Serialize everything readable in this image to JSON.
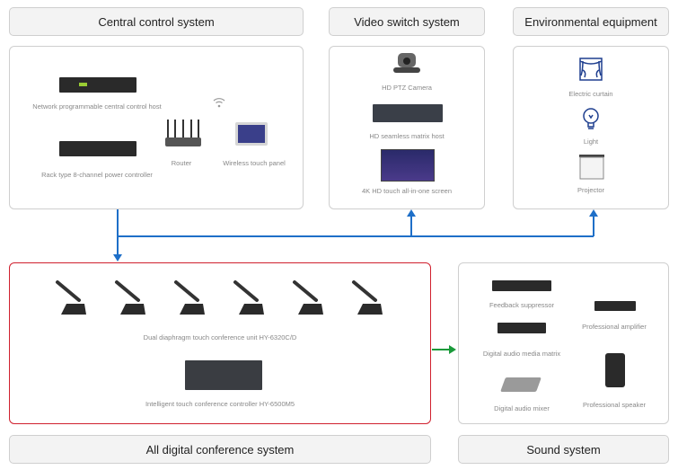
{
  "headers": {
    "central": "Central control system",
    "video": "Video switch system",
    "environment": "Environmental equipment",
    "conference": "All digital conference system",
    "sound": "Sound system"
  },
  "central_items": {
    "host": "Network programmable central control host",
    "power": "Rack type 8-channel power controller",
    "router": "Router",
    "panel": "Wireless touch panel"
  },
  "video_items": {
    "camera": "HD PTZ Camera",
    "matrix": "HD seamless matrix host",
    "screen": "4K HD touch all-in-one screen"
  },
  "env_items": {
    "curtain": "Electric curtain",
    "light": "Light",
    "projector": "Projector"
  },
  "conference_items": {
    "unit": "Dual diaphragm touch conference unit HY-6320C/D",
    "controller": "Intelligent touch conference controller HY-6500M5"
  },
  "sound_items": {
    "feedback": "Feedback suppressor",
    "amplifier": "Professional amplifier",
    "matrix": "Digital audio media matrix",
    "speaker": "Professional speaker",
    "mixer": "Digital audio mixer"
  },
  "colors": {
    "link_blue": "#1e6fc8",
    "highlight_red": "#d0202e",
    "arrow_green": "#1a9a3a",
    "icon_navy": "#1f3f8f"
  }
}
